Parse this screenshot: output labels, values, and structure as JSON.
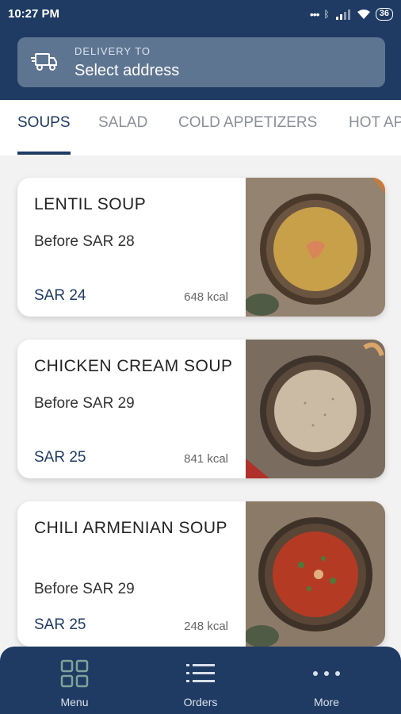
{
  "status_bar": {
    "time": "10:27 PM",
    "battery": "36"
  },
  "delivery": {
    "label": "DELIVERY TO",
    "value": "Select address"
  },
  "tabs": [
    {
      "label": "SOUPS",
      "active": true
    },
    {
      "label": "SALAD",
      "active": false
    },
    {
      "label": "COLD APPETIZERS",
      "active": false
    },
    {
      "label": "HOT APPETIZERS",
      "active": false
    }
  ],
  "items": [
    {
      "name": "LENTIL SOUP",
      "before": "Before SAR 28",
      "price": "SAR 24",
      "kcal": "648 kcal",
      "soup_color": "#c9a04a"
    },
    {
      "name": "CHICKEN CREAM SOUP",
      "before": "Before SAR 29",
      "price": "SAR 25",
      "kcal": "841 kcal",
      "soup_color": "#cbbba5"
    },
    {
      "name": "CHILI ARMENIAN SOUP",
      "before": "Before SAR 29",
      "price": "SAR 25",
      "kcal": "248 kcal",
      "soup_color": "#b53a24"
    }
  ],
  "nav": [
    {
      "label": "Menu",
      "icon": "grid-icon"
    },
    {
      "label": "Orders",
      "icon": "list-icon"
    },
    {
      "label": "More",
      "icon": "more-dots-icon"
    }
  ],
  "colors": {
    "primary": "#1f3b63",
    "accent_green": "#7fa39a"
  }
}
